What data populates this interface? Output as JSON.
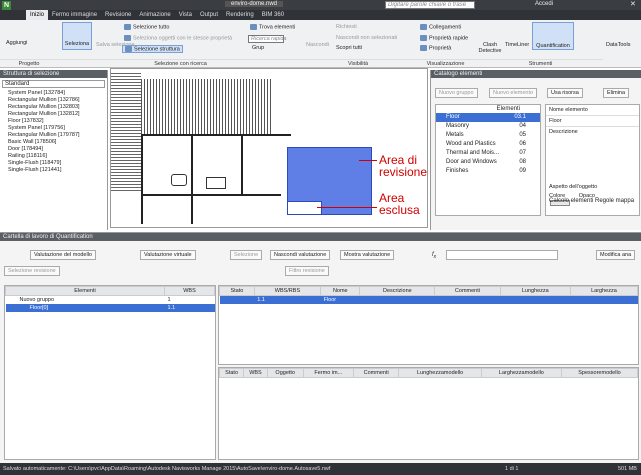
{
  "title": {
    "file": "enviro-dome.nwd",
    "search_placeholder": "Digitare parole chiave o frase",
    "login": "Accedi"
  },
  "tabs": [
    "Inizio",
    "Fermo immagine",
    "Revisione",
    "Animazione",
    "Vista",
    "Output",
    "Rendering",
    "BIM 360"
  ],
  "ribbon": {
    "aggiungi": "Aggiungi",
    "progetto": "Progetto",
    "seleziona": "Seleziona",
    "salva_sel": "Salva selezione",
    "sel_tutto": "Selezione tutto",
    "sel_stesse": "Seleziona oggetti con le stesse proprietà",
    "sel_struttura": "Selezione struttura",
    "trova": "Trova elementi",
    "ricerca_rapida": "Ricerca rapida",
    "grup": "Grup",
    "sel_ricerca": "Selezione con ricerca",
    "nascondi": "Nascondi",
    "richiesti": "Richiesti",
    "nasc_non_sel": "Nascondi non selezionati",
    "scopri": "Scopri tutti",
    "visibilita": "Visibilità",
    "collegamenti": "Collegamenti",
    "prop_rapide": "Proprietà rapide",
    "proprieta": "Proprietà",
    "visualizzazione": "Visualizzazione",
    "clash": "Clash Detective",
    "timeliner": "TimeLiner",
    "quantification": "Quantification",
    "strumenti": "Strumenti",
    "datatools": "DataTools"
  },
  "tree": {
    "title": "Struttura di selezione",
    "dropdown": "Standard",
    "items": [
      "System Panel [132784]",
      "Rectangular Mullion [132786]",
      "Rectangular Mullion [132803]",
      "Rectangular Mullion [132812]",
      "Floor [137832]",
      "System Panel [179756]",
      "Rectangular Mullion [179787]",
      "Basic Wall [178506]",
      "Door [178494]",
      "Railing [118116]",
      "Single-Flush [118479]",
      "Single-Flush [121441]"
    ]
  },
  "drawing": {
    "area_rev_1": "Area di",
    "area_rev_2": "revisione",
    "area_esc_1": "Area",
    "area_esc_2": "esclusa"
  },
  "catalog": {
    "title": "Catalogo elementi",
    "nuovo_gruppo": "Nuovo gruppo",
    "nuovo_elemento": "Nuovo elemento",
    "usa_risorsa": "Usa risorsa",
    "elimina": "Elimina",
    "col_elementi": "Elementi",
    "items": [
      {
        "name": "Floor",
        "code": "03.1"
      },
      {
        "name": "Masonry",
        "code": "04"
      },
      {
        "name": "Metals",
        "code": "05"
      },
      {
        "name": "Wood and Plastics",
        "code": "06"
      },
      {
        "name": "Thermal and Mois...",
        "code": "07"
      },
      {
        "name": "Door and Windows",
        "code": "08"
      },
      {
        "name": "Finishes",
        "code": "09"
      }
    ],
    "nome_elemento": "Nome elemento",
    "nome_value": "Floor",
    "descrizione": "Descrizione",
    "aspetto": "Aspetto dell'oggetto",
    "colore": "Colore",
    "opaco": "Opaco",
    "calcolo": "Calcolo elementi",
    "regole": "Regole mappa"
  },
  "workbench": {
    "title": "Cartella di lavoro di Quantification",
    "val_modello": "Valutazione del modello",
    "val_virtuale": "Valutazione virtuale",
    "selezione": "Selezione",
    "nasc_val": "Nascondi valutazione",
    "mostra_val": "Mostra valutazione",
    "sel_revisione": "Selezione revisione",
    "filtro": "Filtro revisione",
    "modifica": "Modifica ana",
    "col_elementi": "Elementi",
    "col_wbs": "WBS",
    "groups": [
      {
        "name": "Nuovo gruppo",
        "wbs": "1"
      },
      {
        "name": "Floor[0]",
        "wbs": "1.1"
      }
    ],
    "upper_headers": [
      "Stato",
      "WBS/RBS",
      "Nome",
      "Descrizione",
      "Commenti",
      "Lunghezza",
      "Larghezza"
    ],
    "upper_row": {
      "wbs": "1.1",
      "name": "Floor"
    },
    "lower_headers": [
      "Stato",
      "WBS",
      "Oggetto",
      "Fermo im...",
      "Commenti",
      "Lunghezzamodello",
      "Larghezzamodello",
      "Spessoremodello"
    ]
  },
  "status": {
    "text": "Salvato automaticamente: C:\\Users\\pvc\\AppData\\Roaming\\Autodesk Navisworks Manage 2015\\AutoSave\\enviro-dome.Autosave5.nwf",
    "page": "1 di 1",
    "mem": "501 MB"
  },
  "colors": {
    "accent": "#3b6fd4",
    "revision_area": "#5f7ee6",
    "annotation": "#d00000"
  }
}
